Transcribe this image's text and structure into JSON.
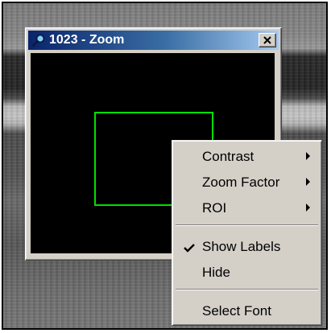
{
  "window": {
    "title": "1023 - Zoom",
    "title_icon": "magnifier-icon",
    "close_icon": "close-icon",
    "roi_color": "#00e000"
  },
  "context_menu": {
    "items": [
      {
        "label": "Contrast",
        "submenu": true
      },
      {
        "label": "Zoom Factor",
        "submenu": true
      },
      {
        "label": "ROI",
        "submenu": true
      },
      {
        "label": "Show Labels",
        "checked": true
      },
      {
        "label": "Hide"
      },
      {
        "label": "Select Font"
      }
    ]
  }
}
